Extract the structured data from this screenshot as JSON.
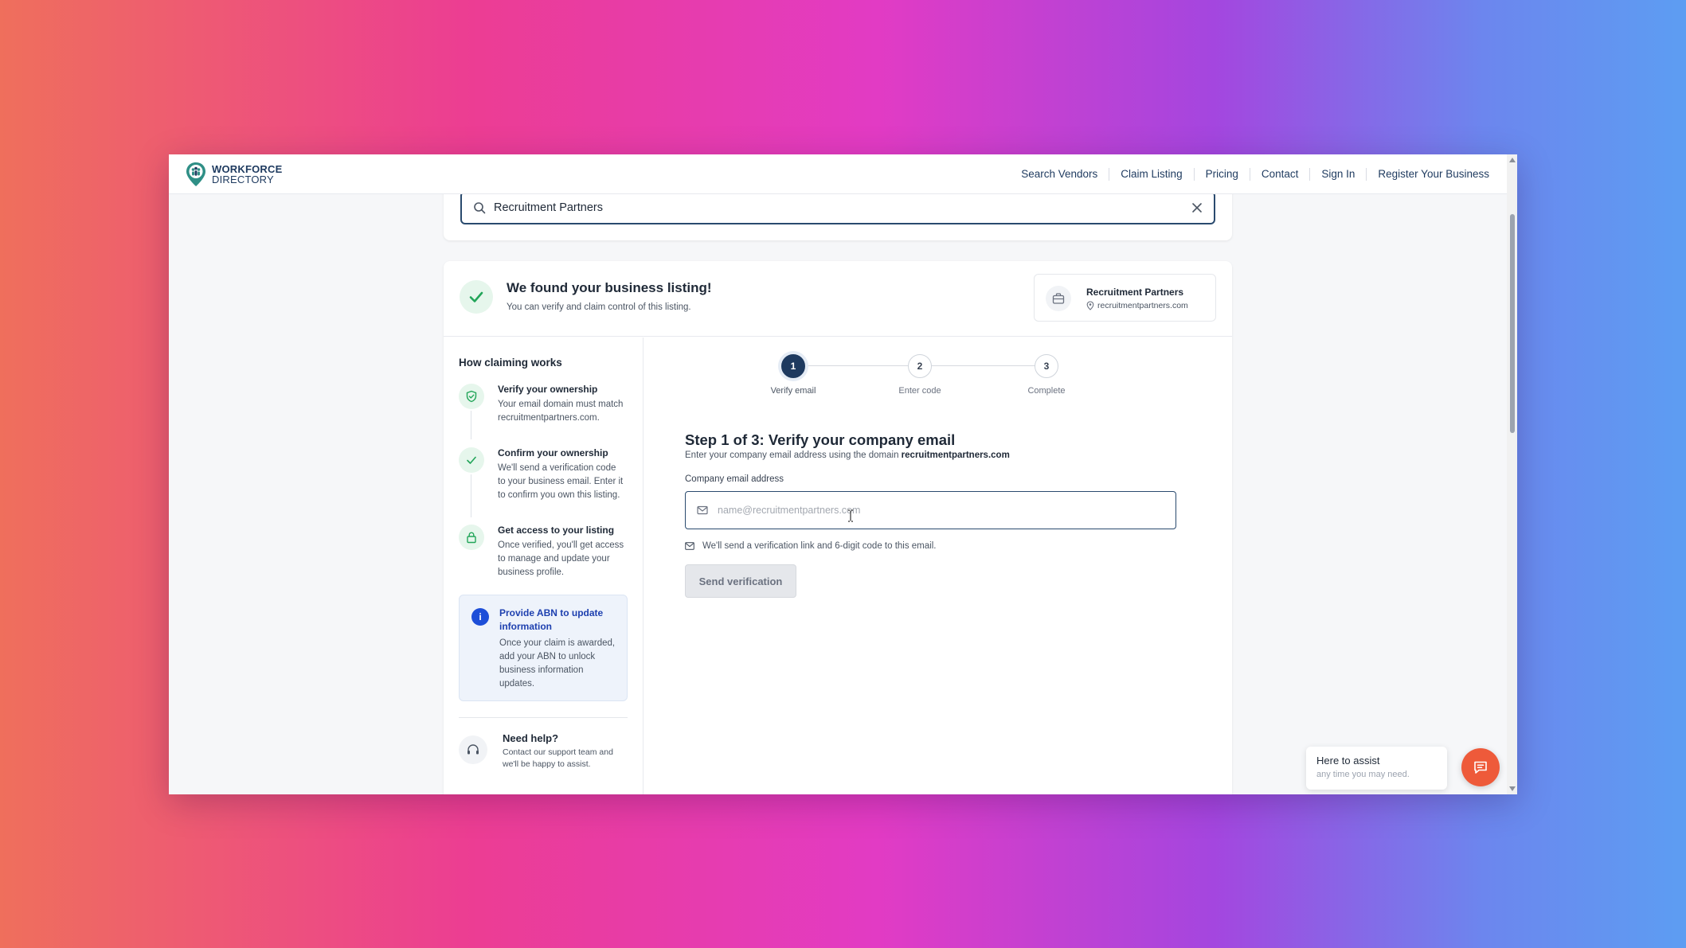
{
  "nav": {
    "brand_line1": "WORKFORCE",
    "brand_line2": "DIRECTORY",
    "links": [
      "Search Vendors",
      "Claim Listing",
      "Pricing",
      "Contact",
      "Sign In",
      "Register Your Business"
    ]
  },
  "search": {
    "value": "Recruitment Partners"
  },
  "found": {
    "title": "We found your business listing!",
    "subtitle": "You can verify and claim control of this listing.",
    "business_name": "Recruitment Partners",
    "business_domain": "recruitmentpartners.com"
  },
  "how": {
    "title": "How claiming works",
    "steps": [
      {
        "title": "Verify your ownership",
        "body": "Your email domain must match recruitmentpartners.com.",
        "icon": "shield-check-icon"
      },
      {
        "title": "Confirm your ownership",
        "body": "We'll send a verification code to your business email. Enter it to confirm you own this listing.",
        "icon": "check-icon"
      },
      {
        "title": "Get access to your listing",
        "body": "Once verified, you'll get access to manage and update your business profile.",
        "icon": "lock-icon"
      }
    ],
    "abn_title": "Provide ABN to update information",
    "abn_body": "Once your claim is awarded, add your ABN to unlock business information updates.",
    "help_title": "Need help?",
    "help_body": "Contact our support team and we'll be happy to assist."
  },
  "stepper": {
    "steps": [
      {
        "number": "1",
        "label": "Verify email"
      },
      {
        "number": "2",
        "label": "Enter code"
      },
      {
        "number": "3",
        "label": "Complete"
      }
    ],
    "active_step": 1
  },
  "form": {
    "title": "Step 1 of 3: Verify your company email",
    "subtitle_prefix": "Enter your company email address using the domain ",
    "subtitle_domain": "recruitmentpartners.com",
    "field_label": "Company email address",
    "email_placeholder": "name@recruitmentpartners.com",
    "email_value": "",
    "note": "We'll send a verification link and 6-digit code to this email.",
    "button_label": "Send verification"
  },
  "chat": {
    "title": "Here to assist",
    "subtitle": "any time you may need."
  },
  "colors": {
    "brand_navy": "#1e3a5f",
    "success_green": "#22a559",
    "info_blue": "#1d4ed8",
    "chat_orange": "#ee5a3a"
  }
}
